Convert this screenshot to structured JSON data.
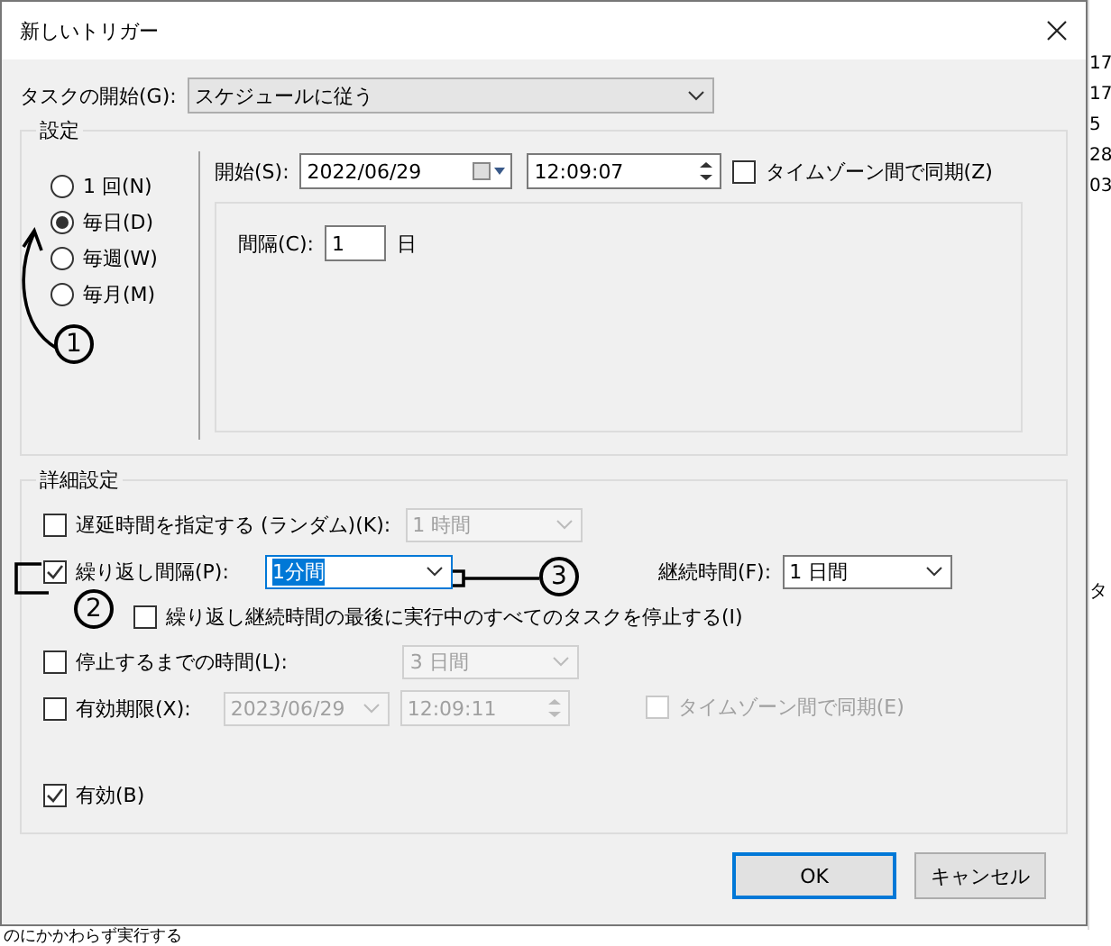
{
  "window": {
    "title": "新しいトリガー"
  },
  "task_start": {
    "label": "タスクの開始(G):",
    "value": "スケジュールに従う"
  },
  "settings": {
    "title": "設定",
    "schedule": [
      {
        "label": "1 回(N)",
        "selected": false
      },
      {
        "label": "毎日(D)",
        "selected": true
      },
      {
        "label": "毎週(W)",
        "selected": false
      },
      {
        "label": "毎月(M)",
        "selected": false
      }
    ],
    "start": {
      "label": "開始(S):",
      "date": "2022/06/29",
      "time": "12:09:07",
      "sync": {
        "label": "タイムゾーン間で同期(Z)",
        "checked": false
      }
    },
    "interval": {
      "label": "間隔(C):",
      "value": "1",
      "unit": "日"
    }
  },
  "advanced": {
    "title": "詳細設定",
    "delay": {
      "label": "遅延時間を指定する (ランダム)(K):",
      "checked": false,
      "value": "1 時間",
      "disabled": true
    },
    "repeat": {
      "label": "繰り返し間隔(P):",
      "checked": true,
      "value": "1分間",
      "value_selected": true,
      "duration_label": "継続時間(F):",
      "duration": "1 日間",
      "stop_all": {
        "label": "繰り返し継続時間の最後に実行中のすべてのタスクを停止する(I)",
        "checked": false
      }
    },
    "stop_after": {
      "label": "停止するまでの時間(L):",
      "checked": false,
      "value": "3 日間",
      "disabled": true
    },
    "expire": {
      "label": "有効期限(X):",
      "checked": false,
      "date": "2023/06/29",
      "time": "12:09:11",
      "disabled": true,
      "sync": {
        "label": "タイムゾーン間で同期(E)",
        "checked": false,
        "disabled": true
      }
    },
    "enabled": {
      "label": "有効(B)",
      "checked": true
    }
  },
  "buttons": [
    {
      "label": "OK",
      "default": true
    },
    {
      "label": "キャンセル",
      "default": false
    }
  ],
  "annotations": [
    {
      "text": "1"
    },
    {
      "text": "2"
    },
    {
      "text": "3"
    }
  ],
  "background": {
    "column_1": [
      "17",
      "17",
      "5",
      "28",
      "03"
    ],
    "column_2": [
      "タ"
    ],
    "bottom_text": "のにかかわらず実行する"
  }
}
